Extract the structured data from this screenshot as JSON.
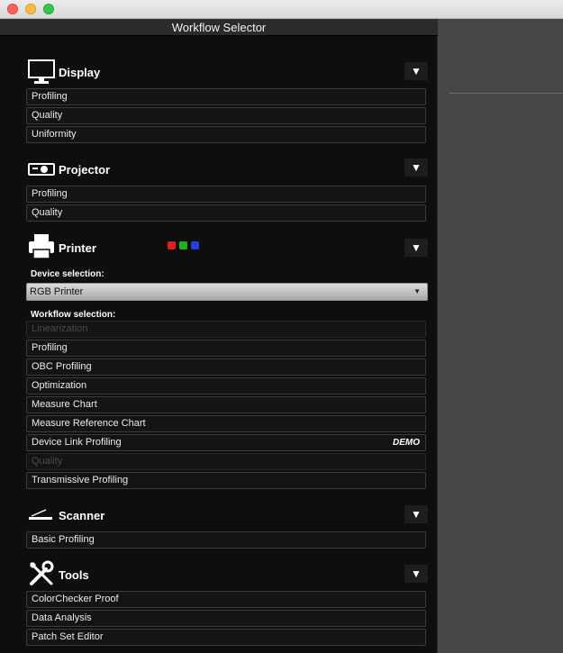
{
  "window": {
    "title": "Workflow Selector"
  },
  "sections": {
    "display": {
      "title": "Display",
      "items": [
        "Profiling",
        "Quality",
        "Uniformity"
      ]
    },
    "projector": {
      "title": "Projector",
      "items": [
        "Profiling",
        "Quality"
      ]
    },
    "printer": {
      "title": "Printer",
      "device_selection_label": "Device selection:",
      "device_selected": "RGB Printer",
      "workflow_selection_label": "Workflow selection:",
      "items": [
        {
          "label": "Linearization",
          "enabled": false
        },
        {
          "label": "Profiling",
          "enabled": true
        },
        {
          "label": "OBC Profiling",
          "enabled": true
        },
        {
          "label": "Optimization",
          "enabled": true
        },
        {
          "label": "Measure Chart",
          "enabled": true
        },
        {
          "label": "Measure Reference Chart",
          "enabled": true
        },
        {
          "label": "Device Link Profiling",
          "enabled": true,
          "badge": "DEMO"
        },
        {
          "label": "Quality",
          "enabled": false
        },
        {
          "label": "Transmissive Profiling",
          "enabled": true
        }
      ],
      "status_colors": [
        "#e02020",
        "#20b020",
        "#2040e0"
      ]
    },
    "scanner": {
      "title": "Scanner",
      "items": [
        "Basic Profiling"
      ]
    },
    "tools": {
      "title": "Tools",
      "items": [
        "ColorChecker Proof",
        "Data Analysis",
        "Patch Set Editor"
      ]
    }
  },
  "collapse_glyph": "▼",
  "select_arrow_glyph": "▼"
}
